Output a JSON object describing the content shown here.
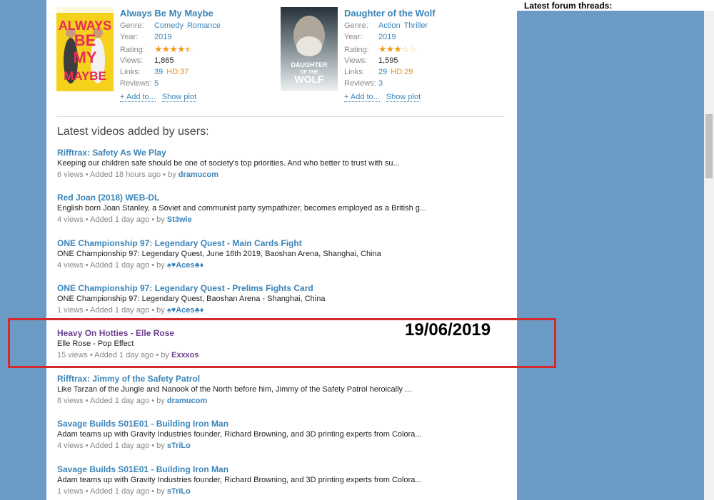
{
  "featured": [
    {
      "title": "Always Be My Maybe",
      "poster_text": [
        "ALWAYS",
        "BE",
        "MY",
        "MAYBE"
      ],
      "genre_label": "Genre:",
      "genres": [
        "Comedy",
        "Romance"
      ],
      "year_label": "Year:",
      "year": "2019",
      "rating_label": "Rating:",
      "rating_stars": 4.5,
      "views_label": "Views:",
      "views": "1,865",
      "links_label": "Links:",
      "links": "39",
      "hd": "HD:37",
      "reviews_label": "Reviews:",
      "reviews": "5",
      "add_to": "+ Add to...",
      "show_plot": "Show plot"
    },
    {
      "title": "Daughter of the Wolf",
      "poster_text": [
        "DAUGHTER",
        "OF THE",
        "WOLF"
      ],
      "genre_label": "Genre:",
      "genres": [
        "Action",
        "Thriller"
      ],
      "year_label": "Year:",
      "year": "2019",
      "rating_label": "Rating:",
      "rating_stars": 3,
      "views_label": "Views:",
      "views": "1,595",
      "links_label": "Links:",
      "links": "29",
      "hd": "HD:29",
      "reviews_label": "Reviews:",
      "reviews": "3",
      "add_to": "+ Add to...",
      "show_plot": "Show plot"
    }
  ],
  "latest_heading": "Latest videos added by users:",
  "videos": [
    {
      "title": "Rifftrax: Safety As We Play",
      "desc": "Keeping our children safe should be one of society's top priorities. And who better to trust with su...",
      "meta": "6 views • Added 18 hours ago • by ",
      "user": "dramucom"
    },
    {
      "title": "Red Joan (2018) WEB-DL",
      "desc": "English born Joan Stanley, a Soviet and communist party sympathizer, becomes employed as a British g...",
      "meta": "4 views • Added 1 day ago • by ",
      "user": "St3wie"
    },
    {
      "title": "ONE Championship 97: Legendary Quest - Main Cards Fight",
      "desc": "ONE Championship 97: Legendary Quest, June 16th 2019, Baoshan Arena, Shanghai, China",
      "meta": "4 views • Added 1 day ago • by ",
      "user": "♠♥Aces♣♦"
    },
    {
      "title": "ONE Championship 97: Legendary Quest - Prelims Fights Card",
      "desc": "ONE Championship 97: Legendary Quest, Baoshan Arena - Shanghai, China",
      "meta": "1 views • Added 1 day ago • by ",
      "user": "♠♥Aces♣♦"
    },
    {
      "title": "Heavy On Hotties - Elle Rose",
      "desc": "Elle Rose - Pop Effect",
      "meta": "15 views • Added 1 day ago • by ",
      "user": "Exxxos",
      "visited": true
    },
    {
      "title": "Rifftrax: Jimmy of the Safety Patrol",
      "desc": "Like Tarzan of the Jungle and Nanook of the North before him, Jimmy of the Safety Patrol heroically ...",
      "meta": "8 views • Added 1 day ago • by ",
      "user": "dramucom"
    },
    {
      "title": "Savage Builds S01E01 - Building Iron Man",
      "desc": "Adam teams up with Gravity Industries founder, Richard Browning, and 3D printing experts from Colora...",
      "meta": "4 views • Added 1 day ago • by ",
      "user": "sTriLo"
    },
    {
      "title": "Savage Builds S01E01 - Building Iron Man",
      "desc": "Adam teams up with Gravity Industries founder, Richard Browning, and 3D printing experts from Colora...",
      "meta": "1 views • Added 1 day ago • by ",
      "user": "sTriLo"
    }
  ],
  "annotation_date": "19/06/2019",
  "forum_title": "Latest forum threads:",
  "colors": {
    "link": "#3a84b8",
    "visited": "#6b3f8e",
    "highlight": "#d32b2b",
    "background": "#6b9ac4",
    "star": "#f09a1a"
  }
}
